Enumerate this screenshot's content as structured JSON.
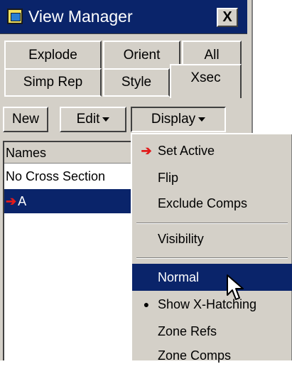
{
  "window": {
    "title": "View Manager",
    "close_label": "X"
  },
  "tabs_row1": [
    {
      "label": "Explode"
    },
    {
      "label": "Orient"
    },
    {
      "label": "All"
    }
  ],
  "tabs_row2": [
    {
      "label": "Simp Rep"
    },
    {
      "label": "Style"
    },
    {
      "label": "Xsec"
    }
  ],
  "active_tab": "Xsec",
  "toolbar": {
    "new_label": "New",
    "edit_label": "Edit",
    "display_label": "Display"
  },
  "list": {
    "header": "Names",
    "rows": [
      {
        "label": "No Cross Section",
        "marker": ""
      },
      {
        "label": "A",
        "marker": "➔"
      }
    ],
    "selected_index": 1
  },
  "menu": {
    "items": [
      {
        "label": "Set Active",
        "glyph": "➔"
      },
      {
        "label": "Flip",
        "glyph": ""
      },
      {
        "label": "Exclude Comps",
        "glyph": ""
      },
      {
        "label": "Visibility",
        "glyph": ""
      },
      {
        "label": "Normal",
        "glyph": ""
      },
      {
        "label": "Show X-Hatching",
        "glyph": "●"
      },
      {
        "label": "Zone Refs",
        "glyph": ""
      },
      {
        "label": "Zone Comps",
        "glyph": ""
      }
    ],
    "highlighted": "Normal"
  },
  "colors": {
    "selection": "#0a246a",
    "arrow": "#e21b1b",
    "face": "#d4d0c8"
  }
}
